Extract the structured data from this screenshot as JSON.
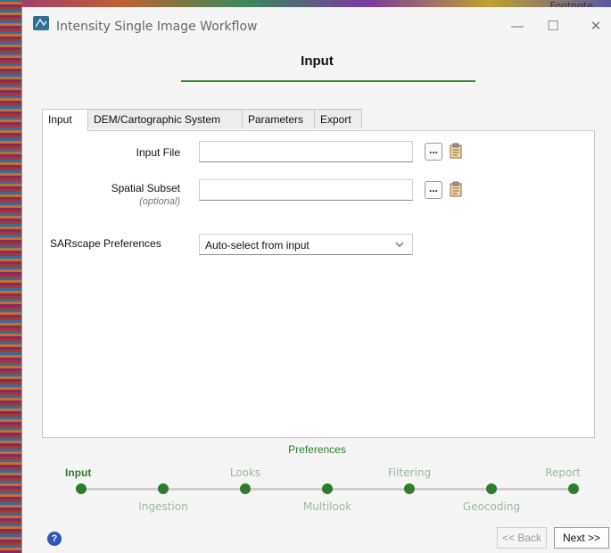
{
  "window": {
    "title": "Intensity Single Image Workflow",
    "minimize": "—",
    "maximize": "☐",
    "close": "✕"
  },
  "background": {
    "fragment": "Footnote ..."
  },
  "stage": {
    "title": "Input"
  },
  "tabs": [
    {
      "label": "Input",
      "active": true
    },
    {
      "label": "DEM/Cartographic System",
      "active": false
    },
    {
      "label": "Parameters",
      "active": false
    },
    {
      "label": "Export",
      "active": false
    }
  ],
  "form": {
    "input_file": {
      "label": "Input File",
      "value": ""
    },
    "spatial_subset": {
      "label": "Spatial Subset",
      "hint": "(optional)",
      "value": ""
    },
    "browse_label": "...",
    "preferences": {
      "label": "SARscape Preferences",
      "selected": "Auto-select from input"
    }
  },
  "workflow": {
    "current_label": "Preferences",
    "steps": [
      {
        "label": "Input",
        "row": "top",
        "active": true
      },
      {
        "label": "Ingestion",
        "row": "bottom",
        "active": false
      },
      {
        "label": "Looks",
        "row": "top",
        "active": false
      },
      {
        "label": "Multilook",
        "row": "bottom",
        "active": false
      },
      {
        "label": "Filtering",
        "row": "top",
        "active": false
      },
      {
        "label": "Geocoding",
        "row": "bottom",
        "active": false
      },
      {
        "label": "Report",
        "row": "top",
        "active": false
      }
    ]
  },
  "footer": {
    "help": "?",
    "back": "<< Back",
    "next": "Next >>"
  },
  "colors": {
    "accent_green": "#2e7d2e",
    "help_blue": "#2f55b8"
  }
}
